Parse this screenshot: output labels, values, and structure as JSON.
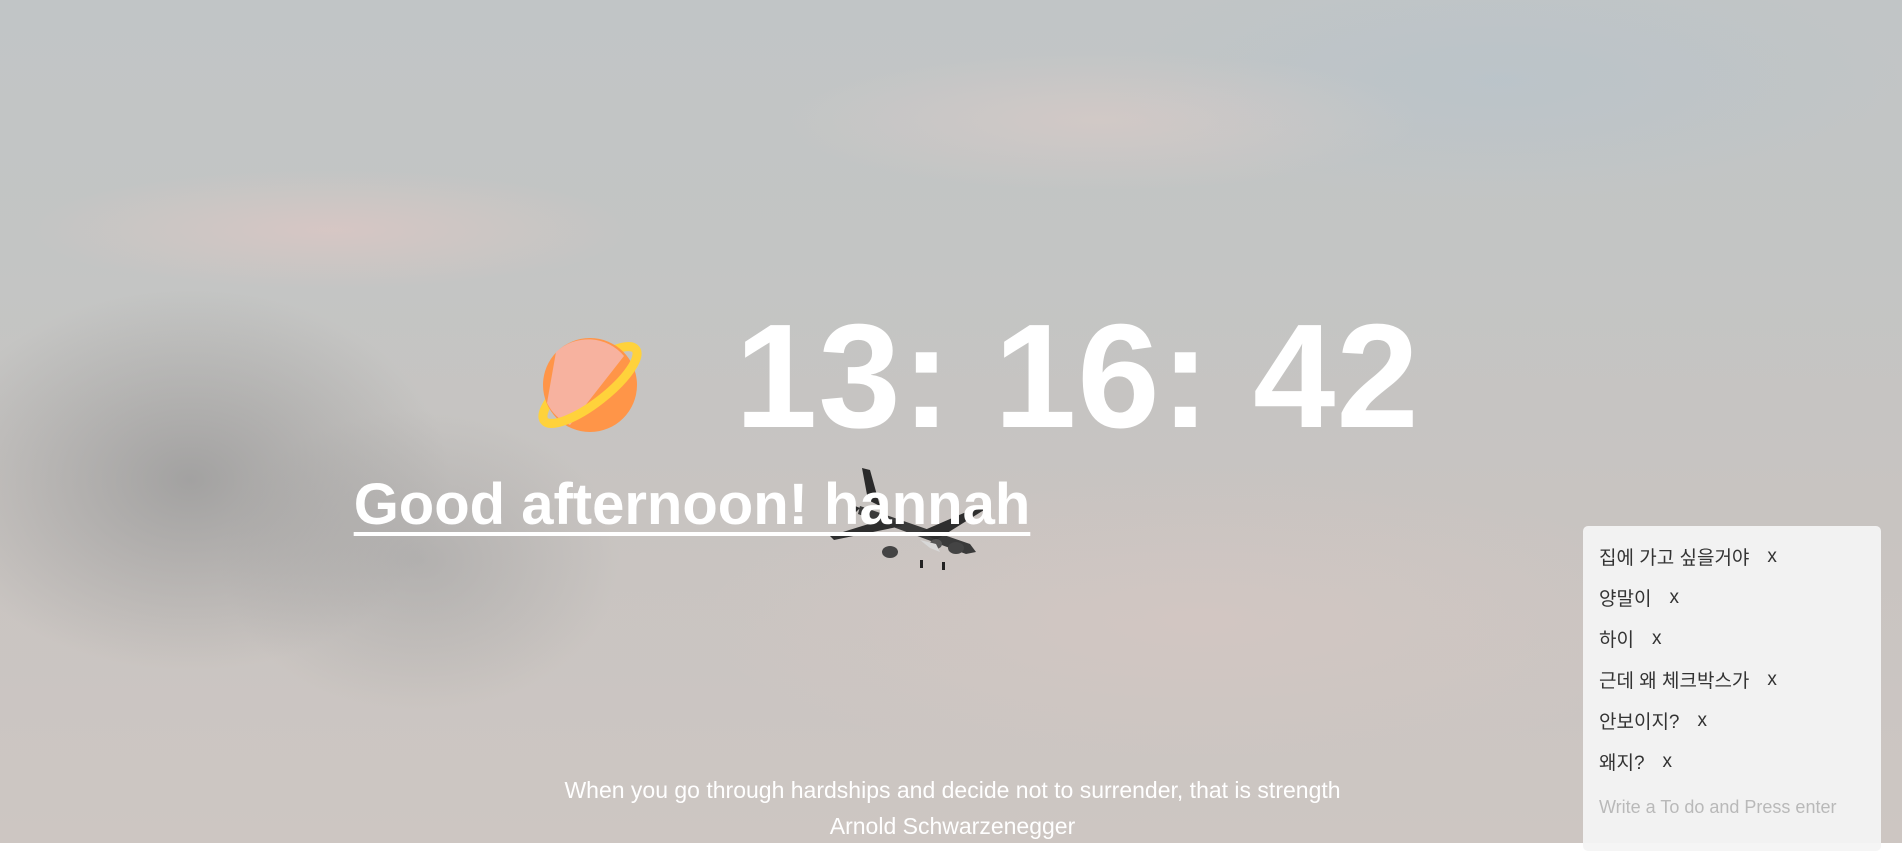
{
  "clock": {
    "time": "13: 16: 42"
  },
  "greeting": {
    "text": "Good afternoon! hannah"
  },
  "quote": {
    "text": "When you go through hardships and decide not to surrender, that is strength",
    "author": "Arnold Schwarzenegger"
  },
  "todo": {
    "items": [
      {
        "text": "집에 가고 싶을거야",
        "delete_label": "x"
      },
      {
        "text": "양말이",
        "delete_label": "x"
      },
      {
        "text": "하이",
        "delete_label": "x"
      },
      {
        "text": "근데 왜 체크박스가",
        "delete_label": "x"
      },
      {
        "text": "안보이지?",
        "delete_label": "x"
      },
      {
        "text": "왜지?",
        "delete_label": "x"
      }
    ],
    "input_placeholder": "Write a To do and Press enter"
  },
  "icons": {
    "planet": "ringed-planet-icon",
    "background": "sky-photo-airplane"
  },
  "colors": {
    "text": "#ffffff",
    "planet_body": "#ff9548",
    "planet_band": "#f7b3a4",
    "planet_ring": "#ffd23b",
    "panel_bg": "#f4f4f4"
  }
}
